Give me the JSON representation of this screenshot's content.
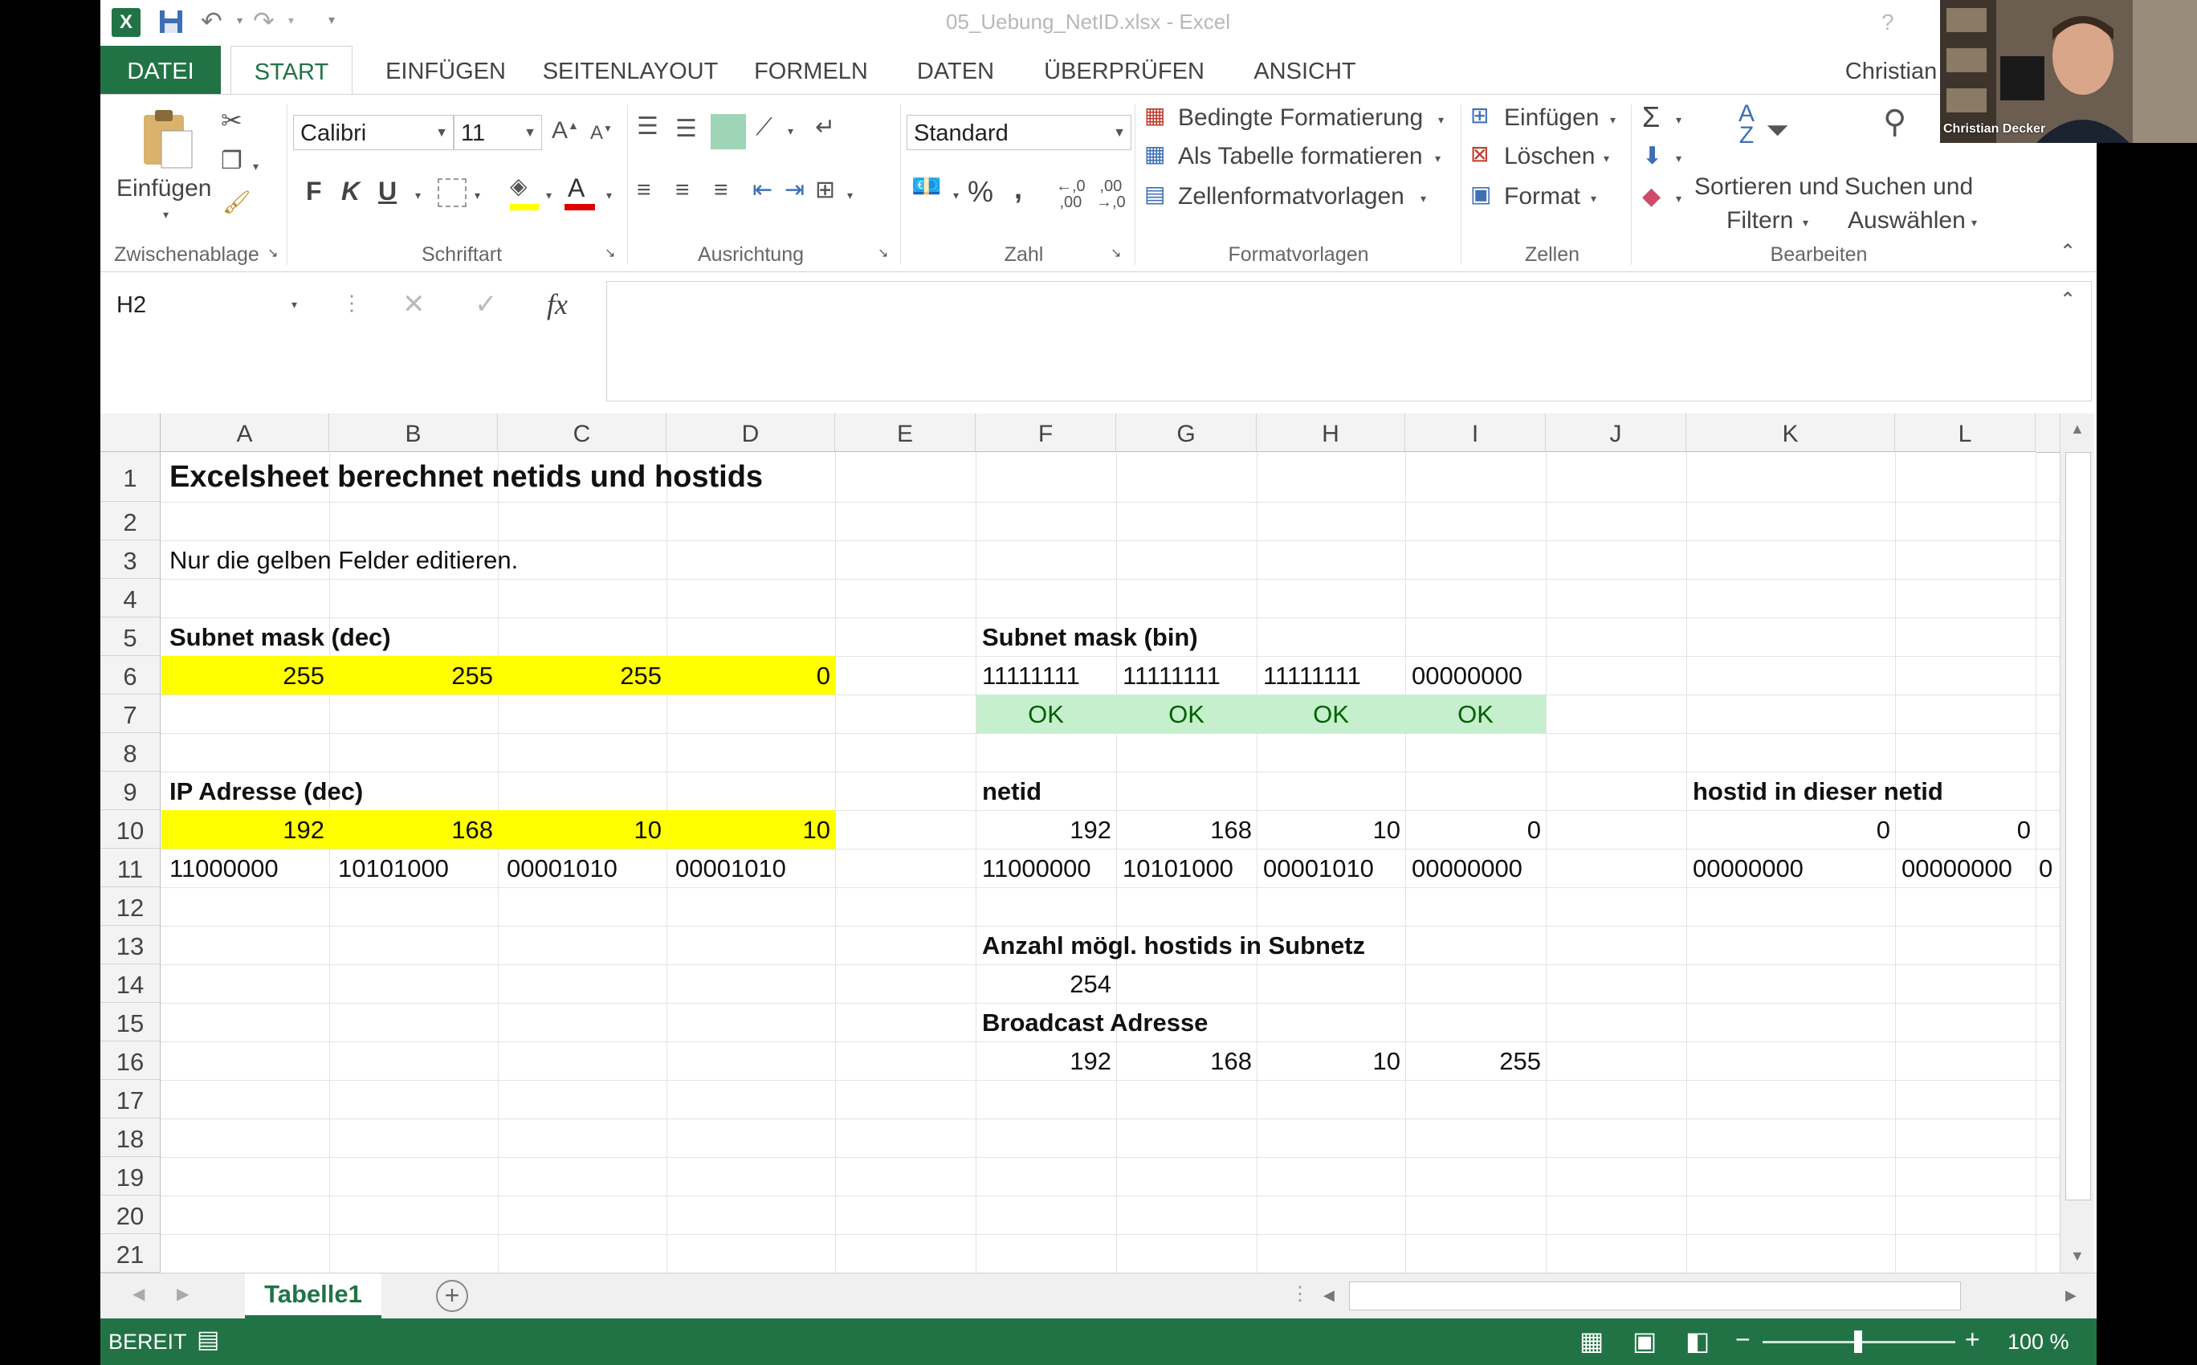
{
  "window": {
    "title": "05_Uebung_NetID.xlsx - Excel",
    "user": "Christian"
  },
  "ribbon": {
    "tabs": [
      "DATEI",
      "START",
      "EINFÜGEN",
      "SEITENLAYOUT",
      "FORMELN",
      "DATEN",
      "ÜBERPRÜFEN",
      "ANSICHT"
    ],
    "clipboard": {
      "paste": "Einfügen",
      "group": "Zwischenablage"
    },
    "font": {
      "name": "Calibri",
      "size": "11",
      "bold": "F",
      "italic": "K",
      "underline": "U",
      "group": "Schriftart"
    },
    "alignment": {
      "group": "Ausrichtung"
    },
    "number": {
      "format": "Standard",
      "percent": "%",
      "comma": ",",
      "group": "Zahl"
    },
    "styles": {
      "conditional": "Bedingte Formatierung",
      "table": "Als Tabelle formatieren",
      "cell_styles": "Zellenformatvorlagen",
      "group": "Formatvorlagen"
    },
    "cells": {
      "insert": "Einfügen",
      "delete": "Löschen",
      "format": "Format",
      "group": "Zellen"
    },
    "editing": {
      "sort_line1": "Sortieren und",
      "sort_line2": "Filtern",
      "find_line1": "Suchen und",
      "find_line2": "Auswählen",
      "group": "Bearbeiten"
    }
  },
  "formula_bar": {
    "name_box": "H2",
    "fx": "fx",
    "value": ""
  },
  "sheet": {
    "columns": [
      "A",
      "B",
      "C",
      "D",
      "E",
      "F",
      "G",
      "H",
      "I",
      "J",
      "K",
      "L"
    ],
    "rows": [
      "1",
      "2",
      "3",
      "4",
      "5",
      "6",
      "7",
      "8",
      "9",
      "10",
      "11",
      "12",
      "13",
      "14",
      "15",
      "16",
      "17",
      "18",
      "19",
      "20",
      "21"
    ],
    "cells": {
      "A1": "Excelsheet berechnet netids und hostids",
      "A3": "Nur die gelben Felder editieren.",
      "A5": "Subnet mask (dec)",
      "A6": "255",
      "B6": "255",
      "C6": "255",
      "D6": "0",
      "F5": "Subnet mask (bin)",
      "F6": "11111111",
      "G6": "11111111",
      "H6": "11111111",
      "I6": "00000000",
      "F7": "OK",
      "G7": "OK",
      "H7": "OK",
      "I7": "OK",
      "A9": "IP Adresse (dec)",
      "A10": "192",
      "B10": "168",
      "C10": "10",
      "D10": "10",
      "A11": "11000000",
      "B11": "10101000",
      "C11": "00001010",
      "D11": "00001010",
      "F9": "netid",
      "F10": "192",
      "G10": "168",
      "H10": "10",
      "I10": "0",
      "F11": "11000000",
      "G11": "10101000",
      "H11": "00001010",
      "I11": "00000000",
      "K9": "hostid in dieser netid",
      "K10": "0",
      "L10": "0",
      "K11": "00000000",
      "L11": "00000000",
      "M11": "0",
      "F13": "Anzahl mögl. hostids in Subnetz",
      "F14": "254",
      "F15": "Broadcast Adresse",
      "F16": "192",
      "G16": "168",
      "H16": "10",
      "I16": "255"
    },
    "tab": "Tabelle1"
  },
  "status": {
    "ready": "BEREIT",
    "zoom": "100 %"
  },
  "video": {
    "name": "Christian Decker"
  },
  "colors": {
    "excel_green": "#217346",
    "input_yellow": "#ffff00",
    "ok_fill": "#c6efce",
    "ok_text": "#006100"
  }
}
